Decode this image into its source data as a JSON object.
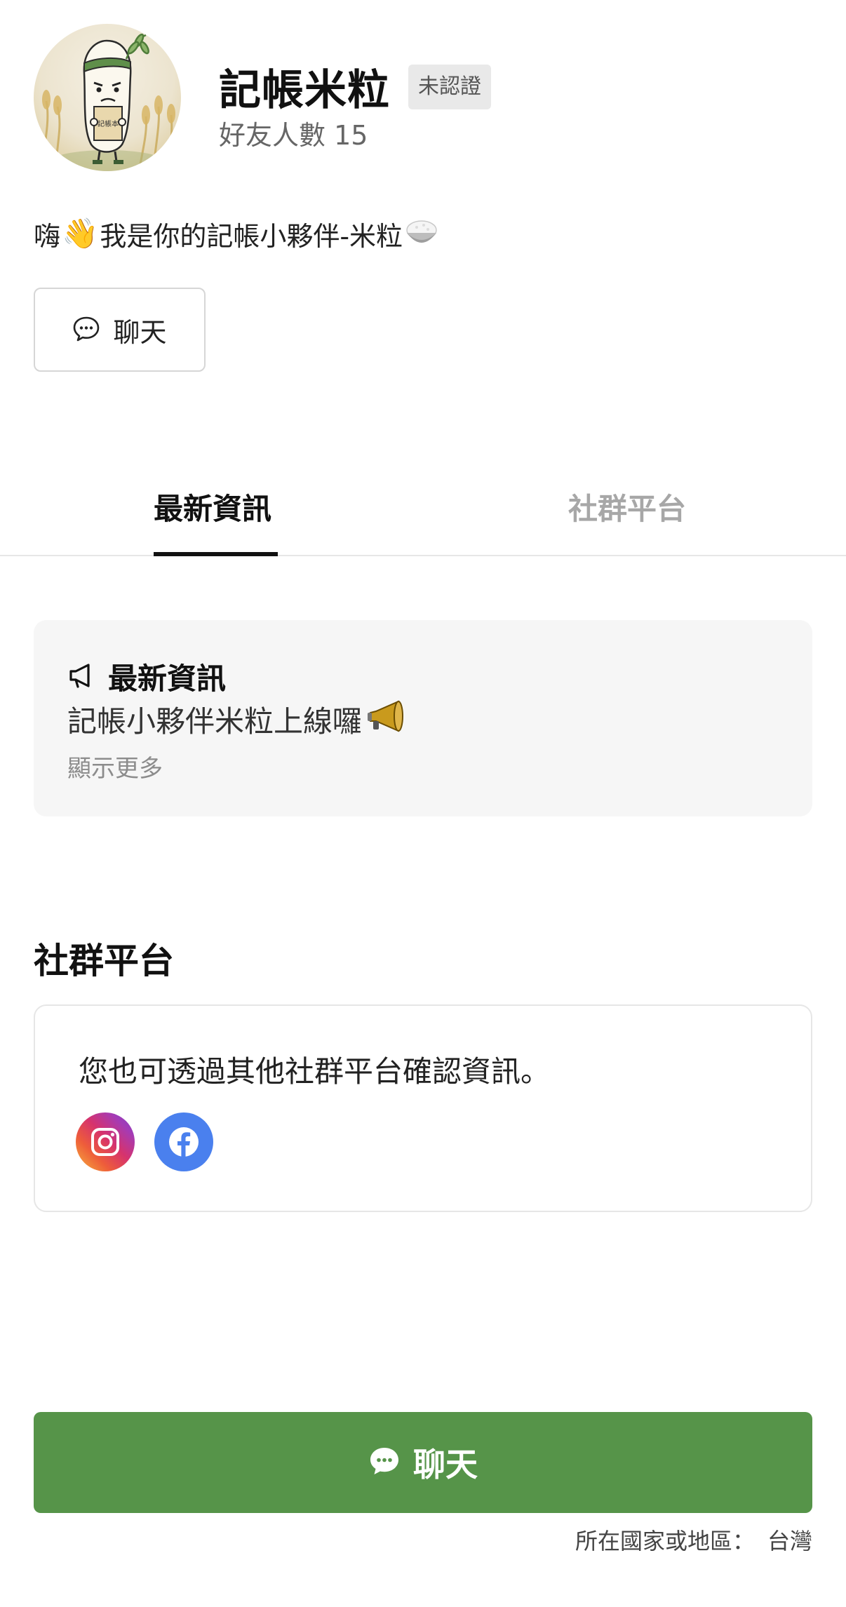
{
  "profile": {
    "name": "記帳米粒",
    "badge": "未認證",
    "friends": "好友人數 15",
    "bio_prefix": "嗨",
    "bio_hand": "👋",
    "bio_text": "我是你的記帳小夥伴-米粒",
    "avatar_book_label": "記帳本",
    "chat_button_label": "聊天"
  },
  "tabs": [
    {
      "label": "最新資訊",
      "active": true
    },
    {
      "label": "社群平台",
      "active": false
    }
  ],
  "news": {
    "title": "最新資訊",
    "text": "記帳小夥伴米粒上線囉",
    "more": "顯示更多"
  },
  "social": {
    "title": "社群平台",
    "description": "您也可透過其他社群平台確認資訊。",
    "platforms": [
      {
        "name": "instagram-icon"
      },
      {
        "name": "facebook-icon"
      }
    ]
  },
  "footer": {
    "chat_button_label": "聊天",
    "region_label": "所在國家或地區：",
    "region_value": "台灣"
  },
  "colors": {
    "primary_green": "#569449",
    "facebook_blue": "#4a80ee",
    "inactive_tab": "#a7a7a7"
  }
}
